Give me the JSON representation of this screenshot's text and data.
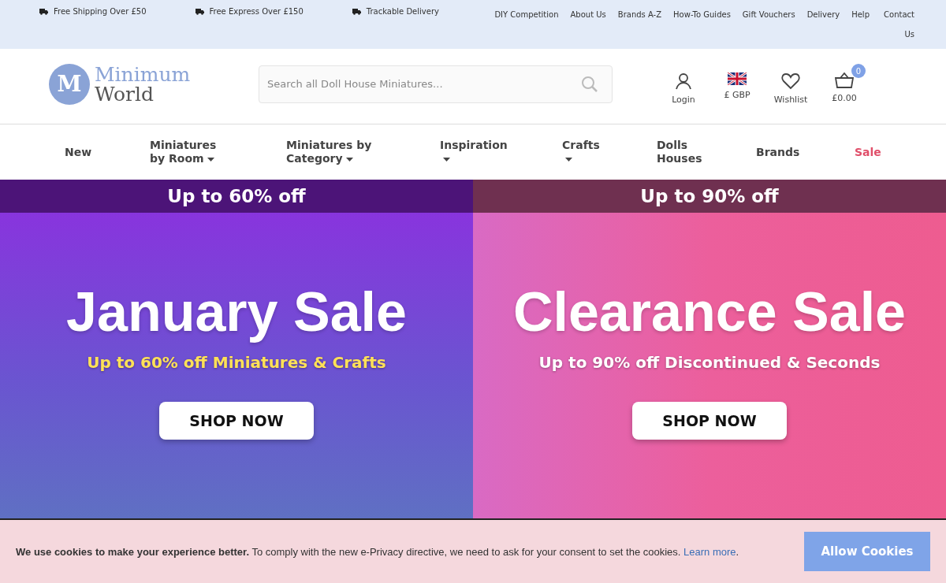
{
  "top_bar": {
    "perks": [
      "Free Shipping Over £50",
      "Free Express Over £150",
      "Trackable Delivery"
    ],
    "links": [
      "DIY Competition",
      "About Us",
      "Brands A-Z",
      "How-To Guides",
      "Gift Vouchers",
      "Delivery",
      "Help",
      "Contact Us"
    ]
  },
  "header": {
    "logo": {
      "mark": "M",
      "line_1": "Minimum",
      "line_2": "World"
    },
    "search": {
      "placeholder": "Search all Doll House Miniatures..."
    },
    "actions": [
      {
        "kind": "account",
        "label": "Login"
      },
      {
        "kind": "currency",
        "label": "£ GBP"
      },
      {
        "kind": "wishlist",
        "label": "Wishlist"
      },
      {
        "kind": "basket",
        "label": "£0.00",
        "badge": "0"
      }
    ]
  },
  "nav": [
    {
      "label": "New",
      "dropdown": false,
      "kind": "normal"
    },
    {
      "label": "Miniatures by Room",
      "dropdown": true,
      "kind": "normal"
    },
    {
      "label": "Miniatures by Category",
      "dropdown": true,
      "kind": "normal"
    },
    {
      "label": "Inspiration",
      "dropdown": true,
      "kind": "normal"
    },
    {
      "label": "Crafts",
      "dropdown": true,
      "kind": "normal"
    },
    {
      "label": "Dolls Houses",
      "dropdown": false,
      "kind": "normal"
    },
    {
      "label": "Brands",
      "dropdown": false,
      "kind": "normal"
    },
    {
      "label": "Sale",
      "dropdown": false,
      "kind": "sale"
    }
  ],
  "banners": [
    {
      "strip": "Up to 60% off",
      "title": "January Sale",
      "subtitle": "Up to 60% off Miniatures & Crafts",
      "button": "SHOP NOW"
    },
    {
      "strip": "Up to 90% off",
      "title": "Clearance Sale",
      "subtitle": "Up to 90% off Discontinued & Seconds",
      "button": "SHOP NOW"
    }
  ],
  "cookie_bar": {
    "message": "**We use cookies to make your experience better.** To comply with the new e-Privacy directive, we need to ask for your consent to set the cookies.",
    "link": "Learn more",
    "after_link": ".",
    "button": "Allow Cookies"
  }
}
